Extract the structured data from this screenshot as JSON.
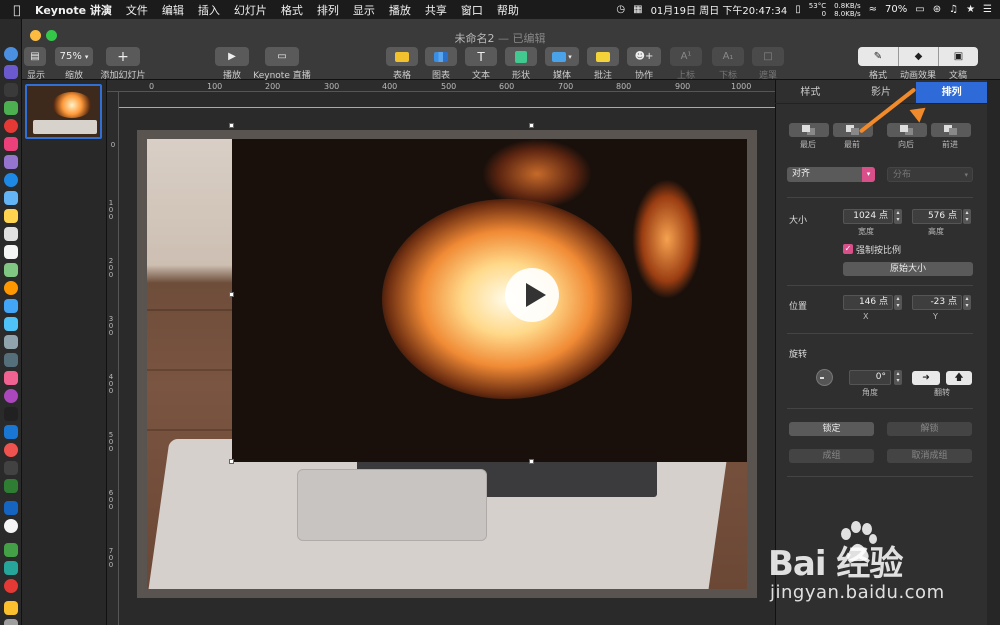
{
  "menubar": {
    "app": "Keynote 讲演",
    "items": [
      "文件",
      "编辑",
      "插入",
      "幻灯片",
      "格式",
      "排列",
      "显示",
      "播放",
      "共享",
      "窗口",
      "帮助"
    ],
    "datetime": "01月19日 周日 下午20:47:34",
    "temp": "53°C",
    "fan": "0",
    "net_up": "0.8KB/s",
    "net_down": "8.0KB/s",
    "battery": "70%"
  },
  "window": {
    "title": "未命名2",
    "status": "— 已编辑"
  },
  "toolbar": {
    "view_label": "显示",
    "zoom_value": "75%",
    "zoom_label": "缩放",
    "add_slide_label": "添加幻灯片",
    "play_label": "播放",
    "live_label": "Keynote 直播",
    "table_label": "表格",
    "chart_label": "图表",
    "text_label": "文本",
    "text_glyph": "T",
    "shape_label": "形状",
    "media_label": "媒体",
    "comment_label": "批注",
    "collab_label": "协作",
    "superscript_label": "上标",
    "subscript_label": "下标",
    "mask_label": "遮罩",
    "format_label": "格式",
    "animate_label": "动画效果",
    "document_label": "文稿"
  },
  "ruler": {
    "marks": [
      "0",
      "100",
      "200",
      "300",
      "400",
      "500",
      "600",
      "700",
      "800",
      "900",
      "1000"
    ],
    "vmarks": [
      "0",
      "100",
      "200",
      "300",
      "400",
      "500",
      "600",
      "700"
    ]
  },
  "inspector": {
    "tabs": [
      "样式",
      "影片",
      "排列"
    ],
    "order": {
      "back": "最后",
      "front": "最前",
      "backward": "向后",
      "forward": "前进"
    },
    "align_select": "对齐",
    "distribute_select": "分布",
    "size_label": "大小",
    "width_value": "1024 点",
    "width_label": "宽度",
    "height_value": "576 点",
    "height_label": "高度",
    "constrain_label": "强制按比例",
    "original_size_button": "原始大小",
    "position_label": "位置",
    "x_value": "146 点",
    "x_label": "X",
    "y_value": "-23 点",
    "y_label": "Y",
    "rotate_label": "旋转",
    "angle_value": "0°",
    "angle_label": "角度",
    "flip_label": "翻转",
    "lock_button": "锁定",
    "unlock_button": "解锁",
    "group_button": "成组",
    "ungroup_button": "取消成组"
  },
  "watermark": {
    "brand": "Bai  经验",
    "url": "jingyan.baidu.com"
  },
  "colors": {
    "accent": "#2e6bd8",
    "annotation_arrow": "#f08a2a",
    "checkbox": "#d94f8a"
  }
}
